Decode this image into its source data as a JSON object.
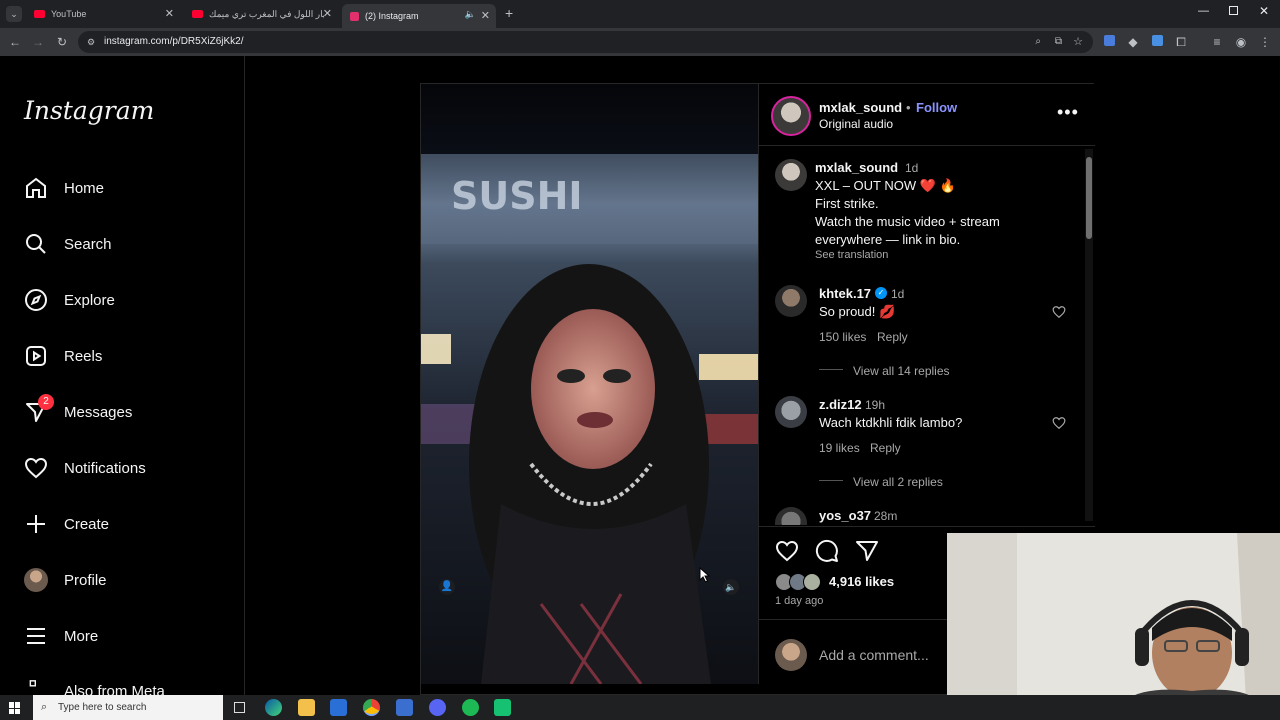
{
  "browser": {
    "tabs": [
      {
        "title": "YouTube",
        "favicon_color": "#ff0033"
      },
      {
        "title": "نهار اللول في المغرب تري ميمك...",
        "favicon_color": "#ff0033"
      },
      {
        "title": "(2) Instagram",
        "favicon_color": "#e1306c"
      }
    ],
    "url": "instagram.com/p/DR5XiZ6jKk2/"
  },
  "sidebar": {
    "logo": "Instagram",
    "items": [
      {
        "label": "Home",
        "icon": "home-icon"
      },
      {
        "label": "Search",
        "icon": "search-icon"
      },
      {
        "label": "Explore",
        "icon": "compass-icon"
      },
      {
        "label": "Reels",
        "icon": "reels-icon"
      },
      {
        "label": "Messages",
        "icon": "messenger-icon",
        "badge": "2"
      },
      {
        "label": "Notifications",
        "icon": "heart-icon"
      },
      {
        "label": "Create",
        "icon": "plus-icon"
      },
      {
        "label": "Profile",
        "icon": "avatar"
      },
      {
        "label": "More",
        "icon": "menu-icon"
      },
      {
        "label": "Also from Meta",
        "icon": "meta-icon"
      }
    ]
  },
  "post": {
    "author": "mxlak_sound",
    "dot": "•",
    "follow": "Follow",
    "audio": "Original audio",
    "caption": {
      "user": "mxlak_sound",
      "time": "1d",
      "line1": "XXL – OUT NOW ❤️ 🔥",
      "line2": "First strike.",
      "line3": "Watch the music video + stream",
      "line4": "everywhere — link in bio.",
      "translate": "See translation"
    },
    "comments": [
      {
        "user": "khtek.17",
        "verified": true,
        "time": "1d",
        "text": "So proud! 💋",
        "likes": "150 likes",
        "reply": "Reply",
        "view_replies": "View all 14 replies"
      },
      {
        "user": "z.diz12",
        "time": "19h",
        "text": "Wach ktdkhli fdik lambo?",
        "likes": "19 likes",
        "reply": "Reply",
        "view_replies": "View all 2 replies"
      },
      {
        "user": "yos_o37",
        "time": "28m"
      }
    ],
    "likes": "4,916 likes",
    "posted": "1 day ago",
    "add_comment": "Add a comment..."
  },
  "taskbar": {
    "search_placeholder": "Type here to search"
  }
}
